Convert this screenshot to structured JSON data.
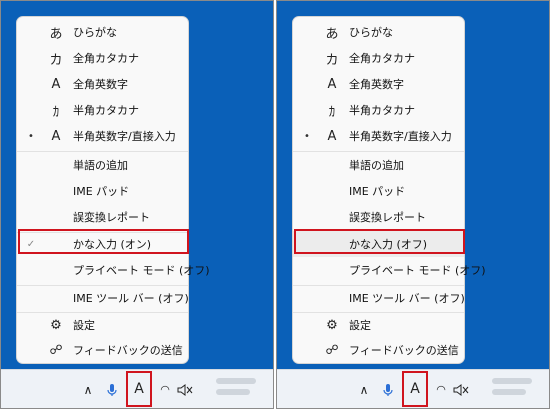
{
  "menus": [
    {
      "items": [
        {
          "glyph": "あ",
          "label": "ひらがな",
          "mark": ""
        },
        {
          "glyph": "カ",
          "label": "全角カタカナ",
          "mark": ""
        },
        {
          "glyph": "A",
          "label": "全角英数字",
          "mark": ""
        },
        {
          "glyph": "ｶ",
          "label": "半角カタカナ",
          "mark": ""
        },
        {
          "glyph": "A",
          "label": "半角英数字/直接入力",
          "mark": "•"
        },
        {
          "glyph": "",
          "label": "単語の追加",
          "mark": ""
        },
        {
          "glyph": "",
          "label": "IME パッド",
          "mark": ""
        },
        {
          "glyph": "",
          "label": "誤変換レポート",
          "mark": ""
        },
        {
          "glyph": "",
          "label": "かな入力 (オン)",
          "mark": "✓"
        },
        {
          "glyph": "",
          "label": "プライベート モード (オフ)",
          "mark": ""
        },
        {
          "glyph": "",
          "label": "IME ツール バー (オフ)",
          "mark": ""
        },
        {
          "glyph": "⚙",
          "label": "設定",
          "mark": ""
        },
        {
          "glyph": "☍",
          "label": "フィードバックの送信",
          "mark": ""
        }
      ]
    },
    {
      "items": [
        {
          "glyph": "あ",
          "label": "ひらがな",
          "mark": ""
        },
        {
          "glyph": "カ",
          "label": "全角カタカナ",
          "mark": ""
        },
        {
          "glyph": "A",
          "label": "全角英数字",
          "mark": ""
        },
        {
          "glyph": "ｶ",
          "label": "半角カタカナ",
          "mark": ""
        },
        {
          "glyph": "A",
          "label": "半角英数字/直接入力",
          "mark": "•"
        },
        {
          "glyph": "",
          "label": "単語の追加",
          "mark": ""
        },
        {
          "glyph": "",
          "label": "IME パッド",
          "mark": ""
        },
        {
          "glyph": "",
          "label": "誤変換レポート",
          "mark": ""
        },
        {
          "glyph": "",
          "label": "かな入力 (オフ)",
          "mark": ""
        },
        {
          "glyph": "",
          "label": "プライベート モード (オフ)",
          "mark": ""
        },
        {
          "glyph": "",
          "label": "IME ツール バー (オフ)",
          "mark": ""
        },
        {
          "glyph": "⚙",
          "label": "設定",
          "mark": ""
        },
        {
          "glyph": "☍",
          "label": "フィードバックの送信",
          "mark": ""
        }
      ]
    }
  ],
  "taskbar": {
    "chevron": "∧",
    "mic": "🎙",
    "ime_indicator": "A",
    "network": "◠",
    "volume": "🔇"
  },
  "colors": {
    "desktop": "#0a60b8",
    "highlight": "#d0141e",
    "menu_bg": "#f9f9f9"
  }
}
